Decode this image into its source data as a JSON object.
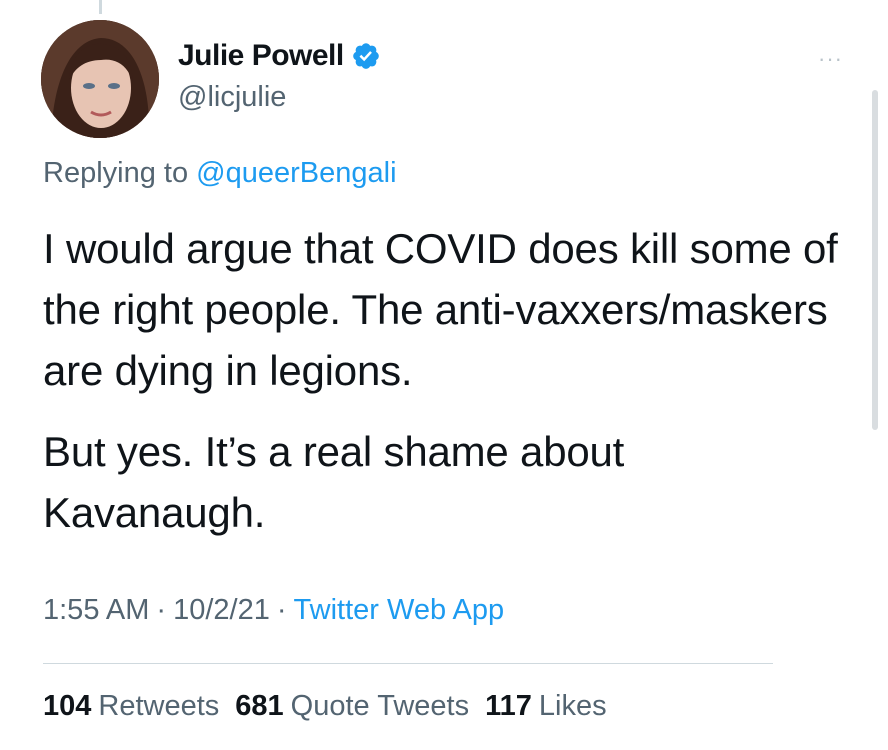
{
  "author": {
    "display_name": "Julie Powell",
    "handle": "@licjulie",
    "verified_icon": "verified-badge-icon"
  },
  "more_icon": "···",
  "reply": {
    "prefix": "Replying to",
    "target": "@queerBengali"
  },
  "tweet": {
    "paragraph_1": "I would argue that COVID does kill some of the right people. The anti-vaxxers/maskers are dying in legions.",
    "paragraph_2": "But yes. It’s a real shame about Kavanaugh."
  },
  "meta": {
    "time": "1:55 AM",
    "separator": "·",
    "date": "10/2/21",
    "source": "Twitter Web App"
  },
  "stats": {
    "retweets_count": "104",
    "retweets_label": "Retweets",
    "quotes_count": "681",
    "quotes_label": "Quote Tweets",
    "likes_count": "117",
    "likes_label": "Likes"
  },
  "colors": {
    "link": "#1d9bf0",
    "secondary_text": "#536471",
    "primary_text": "#0f1419"
  }
}
